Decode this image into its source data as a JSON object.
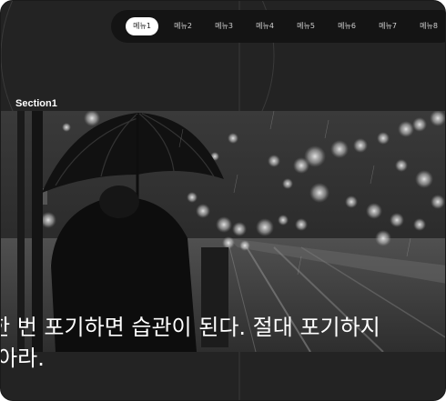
{
  "nav": {
    "items": [
      {
        "label": "메뉴1",
        "active": true
      },
      {
        "label": "메뉴2",
        "active": false
      },
      {
        "label": "메뉴3",
        "active": false
      },
      {
        "label": "메뉴4",
        "active": false
      },
      {
        "label": "메뉴5",
        "active": false
      },
      {
        "label": "메뉴6",
        "active": false
      },
      {
        "label": "메뉴7",
        "active": false
      },
      {
        "label": "메뉴8",
        "active": false
      }
    ]
  },
  "section": {
    "title": "Section1",
    "image_subject": "person-with-umbrella-rainy-night",
    "quote_line1": "한 번 포기하면 습관이 된다. 절대 포기하지",
    "quote_line2": "말아라."
  },
  "colors": {
    "background": "#232323",
    "nav_background": "#141414",
    "active_tab": "#ffffff",
    "text": "#ffffff"
  }
}
